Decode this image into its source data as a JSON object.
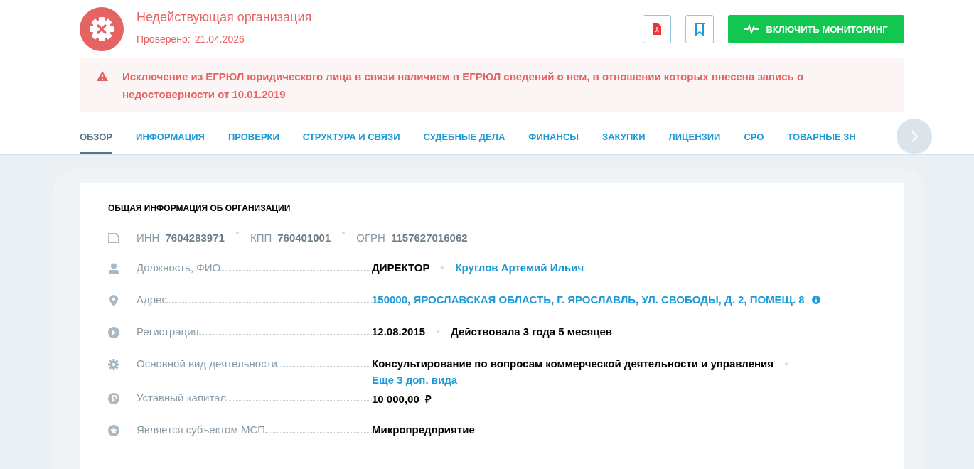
{
  "header": {
    "status_title": "Недействующая организация",
    "checked_label": "Проверено:",
    "checked_date": "21.04.2026",
    "monitoring_button": "ВКЛЮЧИТЬ МОНИТОРИНГ"
  },
  "alert": {
    "text": "Исключение из ЕГРЮЛ юридического лица в связи наличием в ЕГРЮЛ сведений о нем, в отношении которых внесена запись о недостоверности от 10.01.2019"
  },
  "tabs": [
    {
      "label": "ОБЗОР",
      "selected": true
    },
    {
      "label": "ИНФОРМАЦИЯ",
      "selected": false
    },
    {
      "label": "ПРОВЕРКИ",
      "selected": false
    },
    {
      "label": "СТРУКТУРА И СВЯЗИ",
      "selected": false
    },
    {
      "label": "СУДЕБНЫЕ ДЕЛА",
      "selected": false
    },
    {
      "label": "ФИНАНСЫ",
      "selected": false
    },
    {
      "label": "ЗАКУПКИ",
      "selected": false
    },
    {
      "label": "ЛИЦЕНЗИИ",
      "selected": false
    },
    {
      "label": "СРО",
      "selected": false
    },
    {
      "label": "ТОВАРНЫЕ ЗН",
      "selected": false
    }
  ],
  "card": {
    "title": "ОБЩАЯ ИНФОРМАЦИЯ ОБ ОРГАНИЗАЦИИ",
    "ids": [
      {
        "label": "ИНН",
        "value": "7604283971"
      },
      {
        "label": "КПП",
        "value": "760401001"
      },
      {
        "label": "ОГРН",
        "value": "1157627016062"
      }
    ],
    "rows": [
      {
        "label": "Должность, ФИО",
        "values": [
          {
            "text": "ДИРЕКТОР",
            "kind": "plain"
          },
          {
            "text": "Круглов Артемий Ильич",
            "kind": "link"
          }
        ]
      },
      {
        "label": "Адрес",
        "values": [
          {
            "text": "150000, ЯРОСЛАВСКАЯ ОБЛАСТЬ, Г. ЯРОСЛАВЛЬ, УЛ. СВОБОДЫ, Д. 2, ПОМЕЩ. 8",
            "kind": "link"
          }
        ],
        "info": true
      },
      {
        "label": "Регистрация",
        "values": [
          {
            "text": "12.08.2015",
            "kind": "plain"
          },
          {
            "text": "Действовала 3 года 5 месяцев",
            "kind": "plain"
          }
        ]
      },
      {
        "label": "Основной вид деятельности",
        "values": [
          {
            "text": "Консультирование по вопросам коммерческой деятельности и управления",
            "kind": "plain"
          }
        ],
        "trailing_dot": true,
        "more": "Еще 3 доп. вида"
      },
      {
        "label": "Уставный капитал",
        "values": [
          {
            "text": "10 000,00  ₽",
            "kind": "plain"
          }
        ]
      },
      {
        "label": "Является субъектом МСП",
        "values": [
          {
            "text": "Микропредприятие",
            "kind": "plain"
          }
        ]
      }
    ]
  }
}
